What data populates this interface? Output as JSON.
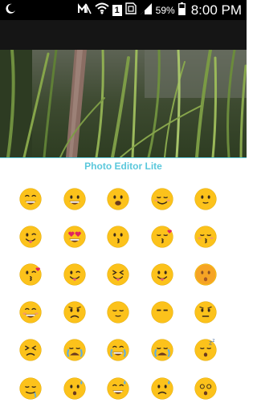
{
  "status_bar": {
    "sim_label": "1",
    "battery": "59%",
    "time": "8:00 PM",
    "icons": [
      "moon-icon",
      "mute-icon",
      "wifi-icon",
      "sim-icon",
      "signal-icon",
      "battery-icon"
    ]
  },
  "title": "Photo Editor Lite",
  "colors": {
    "title": "#5bc8dc",
    "status_bg": "#000000",
    "action_bg": "#151515",
    "emoji_face": "#fcc21b"
  },
  "emoji_grid": {
    "rows": 6,
    "cols": 5,
    "items": [
      "grinning-squint-face",
      "grinning-face",
      "smiling-face-open-mouth",
      "smiling-face",
      "slightly-smiling-face",
      "winking-tongue-face",
      "heart-eyes-face",
      "kissing-face",
      "kissing-face-heart",
      "kissing-smiling-eyes-face",
      "kissing-heart-face",
      "tongue-winking-face",
      "squinting-tongue-face",
      "tongue-out-face",
      "flushed-face",
      "grimacing-smile-face",
      "worried-face",
      "relieved-face",
      "unamused-face",
      "thinking-face",
      "persevering-face",
      "crying-face",
      "tears-of-joy-face",
      "loudly-crying-face",
      "sleeping-face",
      "drooling-face",
      "cold-sweat-face",
      "grinning-sweat-face",
      "anxious-sweat-face",
      "dizzy-face"
    ]
  }
}
